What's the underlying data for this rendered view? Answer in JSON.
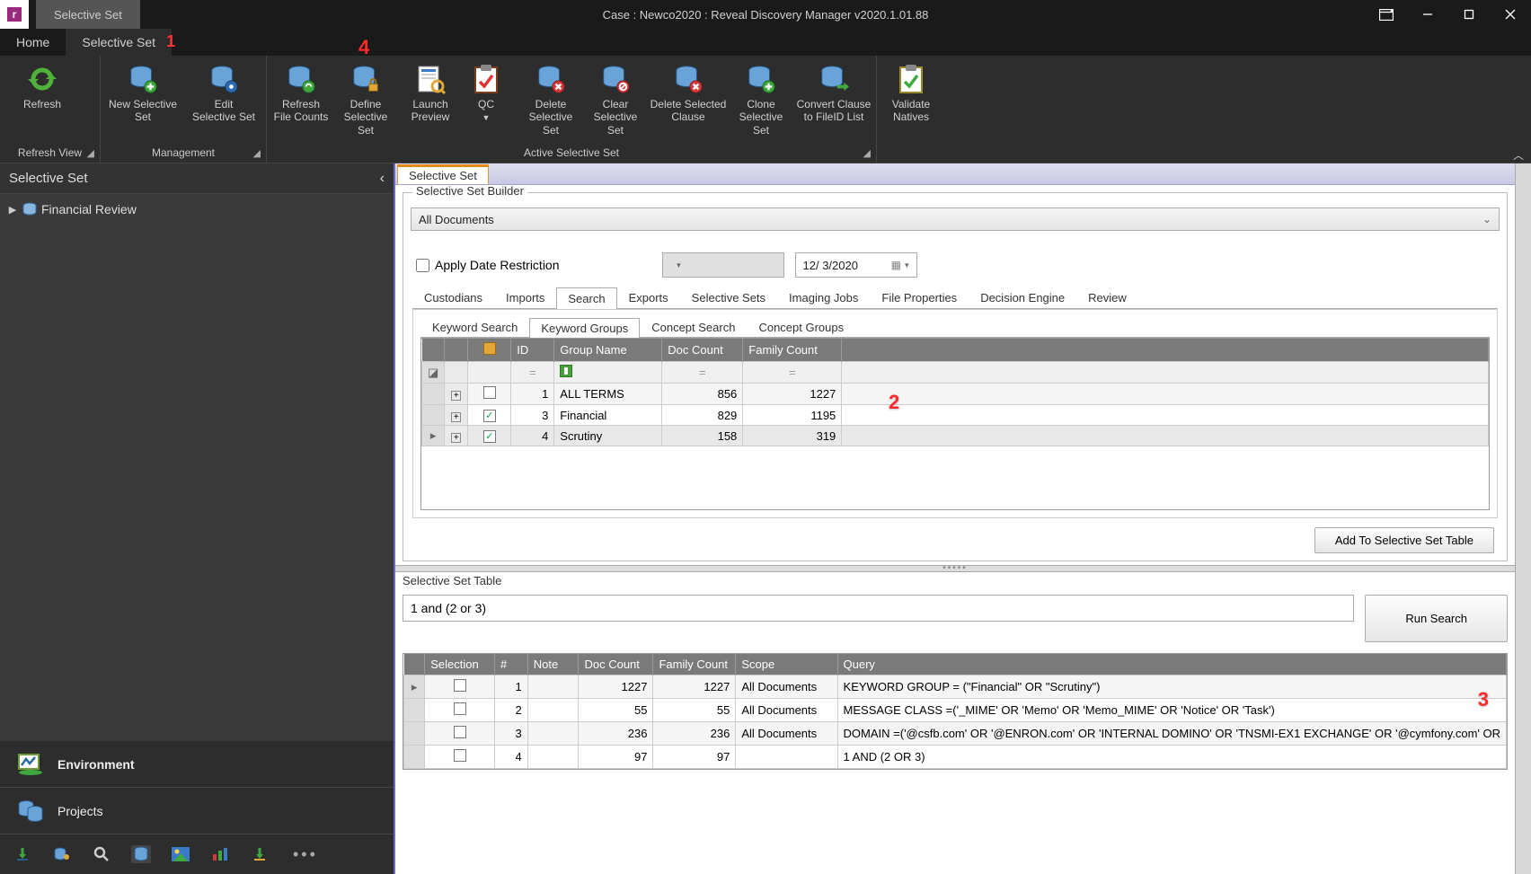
{
  "window": {
    "title": "Case : Newco2020 : Reveal Discovery Manager  v2020.1.01.88",
    "contextualTab": "Selective Set",
    "logoLetter": "r"
  },
  "tabs": {
    "home": "Home",
    "selectiveSet": "Selective Set"
  },
  "annotations": {
    "a1": "1",
    "a2": "2",
    "a3": "3",
    "a4": "4"
  },
  "ribbon": {
    "refresh": "Refresh",
    "refreshViewGroup": "Refresh View",
    "newSelectiveSet": "New Selective\nSet",
    "editSelectiveSet": "Edit\nSelective Set",
    "managementGroup": "Management",
    "refreshFileCounts": "Refresh\nFile Counts",
    "defineSelectiveSet": "Define\nSelective Set",
    "launchPreview": "Launch\nPreview",
    "qc": "QC",
    "deleteSelectiveSet": "Delete\nSelective Set",
    "clearSelectiveSet": "Clear\nSelective Set",
    "deleteSelectedClause": "Delete Selected\nClause",
    "cloneSelectiveSet": "Clone\nSelective Set",
    "convertClause": "Convert Clause\nto FileID List",
    "validateNatives": "Validate\nNatives",
    "activeGroup": "Active Selective Set"
  },
  "sidebar": {
    "title": "Selective Set",
    "treeItem": "Financial Review",
    "navEnvironment": "Environment",
    "navProjects": "Projects"
  },
  "builder": {
    "panelTab": "Selective Set",
    "legend": "Selective Set Builder",
    "scope": "All Documents",
    "applyDate": "Apply Date Restriction",
    "dateValue": "12/ 3/2020",
    "tabs1": [
      "Custodians",
      "Imports",
      "Search",
      "Exports",
      "Selective Sets",
      "Imaging Jobs",
      "File Properties",
      "Decision Engine",
      "Review"
    ],
    "tabs1Active": 2,
    "tabs2": [
      "Keyword Search",
      "Keyword Groups",
      "Concept Search",
      "Concept Groups"
    ],
    "tabs2Active": 1,
    "gridHeaders": {
      "id": "ID",
      "group": "Group Name",
      "doc": "Doc Count",
      "fam": "Family Count"
    },
    "gridRows": [
      {
        "checked": false,
        "id": "1",
        "group": "ALL TERMS",
        "doc": "856",
        "fam": "1227"
      },
      {
        "checked": true,
        "id": "3",
        "group": "Financial",
        "doc": "829",
        "fam": "1195"
      },
      {
        "checked": true,
        "id": "4",
        "group": "Scrutiny",
        "doc": "158",
        "fam": "319"
      }
    ],
    "addBtn": "Add To Selective Set Table"
  },
  "setTable": {
    "legend": "Selective Set Table",
    "query": "1 and (2 or 3)",
    "runSearch": "Run Search",
    "headers": {
      "sel": "Selection",
      "num": "#",
      "note": "Note",
      "doc": "Doc Count",
      "fam": "Family Count",
      "scope": "Scope",
      "query": "Query"
    },
    "rows": [
      {
        "num": "1",
        "doc": "1227",
        "fam": "1227",
        "scope": "All Documents",
        "query": "KEYWORD GROUP = (\"Financial\" OR \"Scrutiny\")"
      },
      {
        "num": "2",
        "doc": "55",
        "fam": "55",
        "scope": "All Documents",
        "query": "MESSAGE CLASS =('_MIME' OR 'Memo' OR 'Memo_MIME' OR 'Notice' OR 'Task')"
      },
      {
        "num": "3",
        "doc": "236",
        "fam": "236",
        "scope": "All Documents",
        "query": "DOMAIN =('@csfb.com' OR '@ENRON.com' OR 'INTERNAL DOMINO' OR 'TNSMI-EX1 EXCHANGE' OR '@cymfony.com' OR"
      },
      {
        "num": "4",
        "doc": "97",
        "fam": "97",
        "scope": "",
        "query": "1 AND (2 OR 3)"
      }
    ]
  }
}
